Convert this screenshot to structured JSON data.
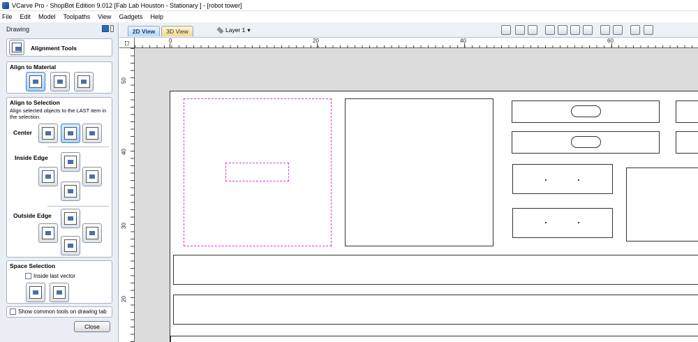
{
  "window": {
    "title": "VCarve Pro - ShopBot Edition 9.012 [Fab Lab Houston - Stationary ] - [robot tower]"
  },
  "menu": [
    "File",
    "Edit",
    "Model",
    "Toolpaths",
    "View",
    "Gadgets",
    "Help"
  ],
  "panel": {
    "title": "Drawing",
    "tool_name": "Alignment Tools",
    "align_material": {
      "heading": "Align to Material"
    },
    "align_selection": {
      "heading": "Align to Selection",
      "description": "Align selected objects to the LAST item in the selection.",
      "center_label": "Center",
      "inside_edge_label": "Inside Edge",
      "outside_edge_label": "Outside Edge"
    },
    "space_selection": {
      "heading": "Space Selection",
      "inside_last_vector": "Inside last vector"
    },
    "show_common": "Show common tools on drawing tab",
    "close_label": "Close"
  },
  "view": {
    "tab_2d": "2D View",
    "tab_3d": "3D View",
    "layer_label": "Layer 1"
  },
  "rulers": {
    "horizontal": [
      "0",
      "20",
      "40",
      "60"
    ],
    "vertical": [
      "50",
      "40",
      "30",
      "20"
    ]
  },
  "colors": {
    "selection": "#d33bd3",
    "accent": "#3c7fc7",
    "panel_bg": "#e9eef5"
  }
}
